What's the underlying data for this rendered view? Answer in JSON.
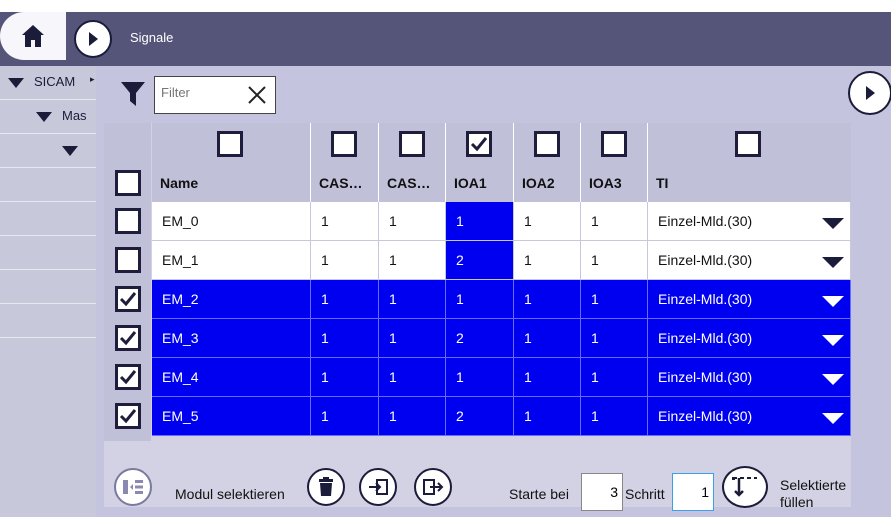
{
  "header": {
    "title": "Signale"
  },
  "tree": {
    "items": [
      {
        "label": "SICAM"
      },
      {
        "label": "Mas"
      },
      {
        "label": ""
      }
    ]
  },
  "filter": {
    "placeholder": "Filter"
  },
  "table": {
    "columns": [
      "Name",
      "CAS…",
      "CAS…",
      "IOA1",
      "IOA2",
      "IOA3",
      "TI"
    ],
    "header_checks": [
      false,
      false,
      false,
      true,
      false,
      false,
      false
    ],
    "rows": [
      {
        "selected": false,
        "name": "EM_0",
        "cas1": "1",
        "cas2": "1",
        "ioa1": "1",
        "ioa2": "1",
        "ioa3": "1",
        "ti": "Einzel-Mld.(30)"
      },
      {
        "selected": false,
        "name": "EM_1",
        "cas1": "1",
        "cas2": "1",
        "ioa1": "2",
        "ioa2": "1",
        "ioa3": "1",
        "ti": "Einzel-Mld.(30)"
      },
      {
        "selected": true,
        "name": "EM_2",
        "cas1": "1",
        "cas2": "1",
        "ioa1": "1",
        "ioa2": "1",
        "ioa3": "1",
        "ti": "Einzel-Mld.(30)"
      },
      {
        "selected": true,
        "name": "EM_3",
        "cas1": "1",
        "cas2": "1",
        "ioa1": "2",
        "ioa2": "1",
        "ioa3": "1",
        "ti": "Einzel-Mld.(30)"
      },
      {
        "selected": true,
        "name": "EM_4",
        "cas1": "1",
        "cas2": "1",
        "ioa1": "1",
        "ioa2": "1",
        "ioa3": "1",
        "ti": "Einzel-Mld.(30)"
      },
      {
        "selected": true,
        "name": "EM_5",
        "cas1": "1",
        "cas2": "1",
        "ioa1": "2",
        "ioa2": "1",
        "ioa3": "1",
        "ti": "Einzel-Mld.(30)"
      }
    ]
  },
  "footer": {
    "modul_label": "Modul selektieren",
    "start_label": "Starte bei",
    "start_value": "3",
    "step_label": "Schritt",
    "step_value": "1",
    "fill_label_1": "Selektierte",
    "fill_label_2": "füllen"
  },
  "colors": {
    "accent": "#0000f0",
    "topbar": "#55557a",
    "panel": "#c4c4de"
  }
}
